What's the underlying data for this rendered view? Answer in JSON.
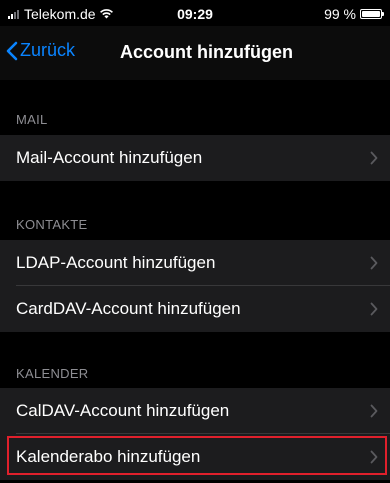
{
  "status_bar": {
    "carrier": "Telekom.de",
    "time": "09:29",
    "battery": "99 %",
    "battery_level": 0.99
  },
  "nav": {
    "back_label": "Zurück",
    "title": "Account hinzufügen"
  },
  "sections": {
    "mail": {
      "header": "MAIL",
      "items": [
        {
          "label": "Mail-Account hinzufügen"
        }
      ]
    },
    "contacts": {
      "header": "KONTAKTE",
      "items": [
        {
          "label": "LDAP-Account hinzufügen"
        },
        {
          "label": "CardDAV-Account hinzufügen"
        }
      ]
    },
    "calendar": {
      "header": "KALENDER",
      "items": [
        {
          "label": "CalDAV-Account hinzufügen"
        },
        {
          "label": "Kalenderabo hinzufügen"
        }
      ]
    }
  },
  "colors": {
    "accent": "#0a84ff",
    "highlight": "#e0202c",
    "row_background": "#1c1c1e",
    "background": "#000000"
  },
  "icons": {
    "back": "chevron-left-icon",
    "row": "chevron-right-icon",
    "wifi": "wifi-icon",
    "signal": "signal-icon",
    "battery": "battery-icon"
  }
}
